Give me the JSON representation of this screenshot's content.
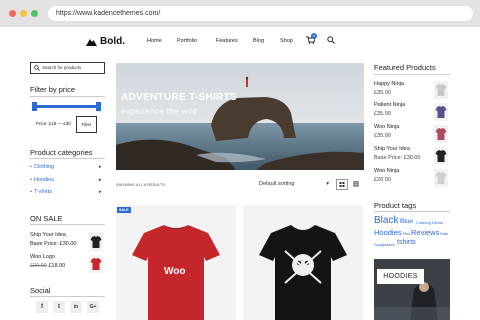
{
  "browser": {
    "url": "https://www.kadencethemes.com/"
  },
  "header": {
    "logo": "Bold.",
    "nav": [
      "Home",
      "Portfolio",
      "Features",
      "Blog",
      "Shop"
    ],
    "cart_count": "0"
  },
  "sidebar_left": {
    "search_placeholder": "Search for products",
    "filter_title": "Filter by price",
    "price_range": "Price: £18 — £30",
    "filter_button": "Filter",
    "categories_title": "Product categories",
    "categories": [
      "Clothing",
      "Hoodies",
      "T-shirts"
    ],
    "on_sale_title": "ON SALE",
    "on_sale": [
      {
        "name": "Ship Your Idea",
        "price_prefix": "Base Price: ",
        "price": "£30.00"
      },
      {
        "name": "Woo Logo",
        "old_price": "£20.00",
        "price": "£18.00"
      }
    ],
    "social_title": "Social",
    "social_icons": [
      "f",
      "t",
      "in",
      "G+"
    ]
  },
  "hero": {
    "title": "ADVENTURE T-SHIRTS",
    "subtitle": "experience the wild"
  },
  "shop": {
    "showing": "SHOWING ALL 6 RESULTS",
    "sort": "Default sorting",
    "sale_badge": "SALE",
    "card1_text": "Woo"
  },
  "sidebar_right": {
    "featured_title": "Featured Products",
    "featured": [
      {
        "name": "Happy Ninja",
        "price": "£35.00",
        "color": "#c8c8c8"
      },
      {
        "name": "Patient Ninja",
        "price": "£35.00",
        "color": "#5e4f8a"
      },
      {
        "name": "Woo Ninja",
        "price": "£35.00",
        "color": "#b04a62"
      },
      {
        "name": "Ship Your Idea",
        "price": "Base Price: £30.00",
        "color": "#222222"
      },
      {
        "name": "Woo Ninja",
        "price": "£20.00",
        "color": "#cfcfcf"
      }
    ],
    "tags_title": "Product tags",
    "tags": [
      "Black",
      "Blue",
      "Clothing",
      "Decks",
      "Hoodies",
      "Red",
      "Reviews",
      "Sale",
      "Sunglasses",
      "tshirts"
    ],
    "promo": "HOODIES"
  },
  "colors": {
    "accent": "#2b6bd6",
    "shirt_red": "#c4262b"
  }
}
